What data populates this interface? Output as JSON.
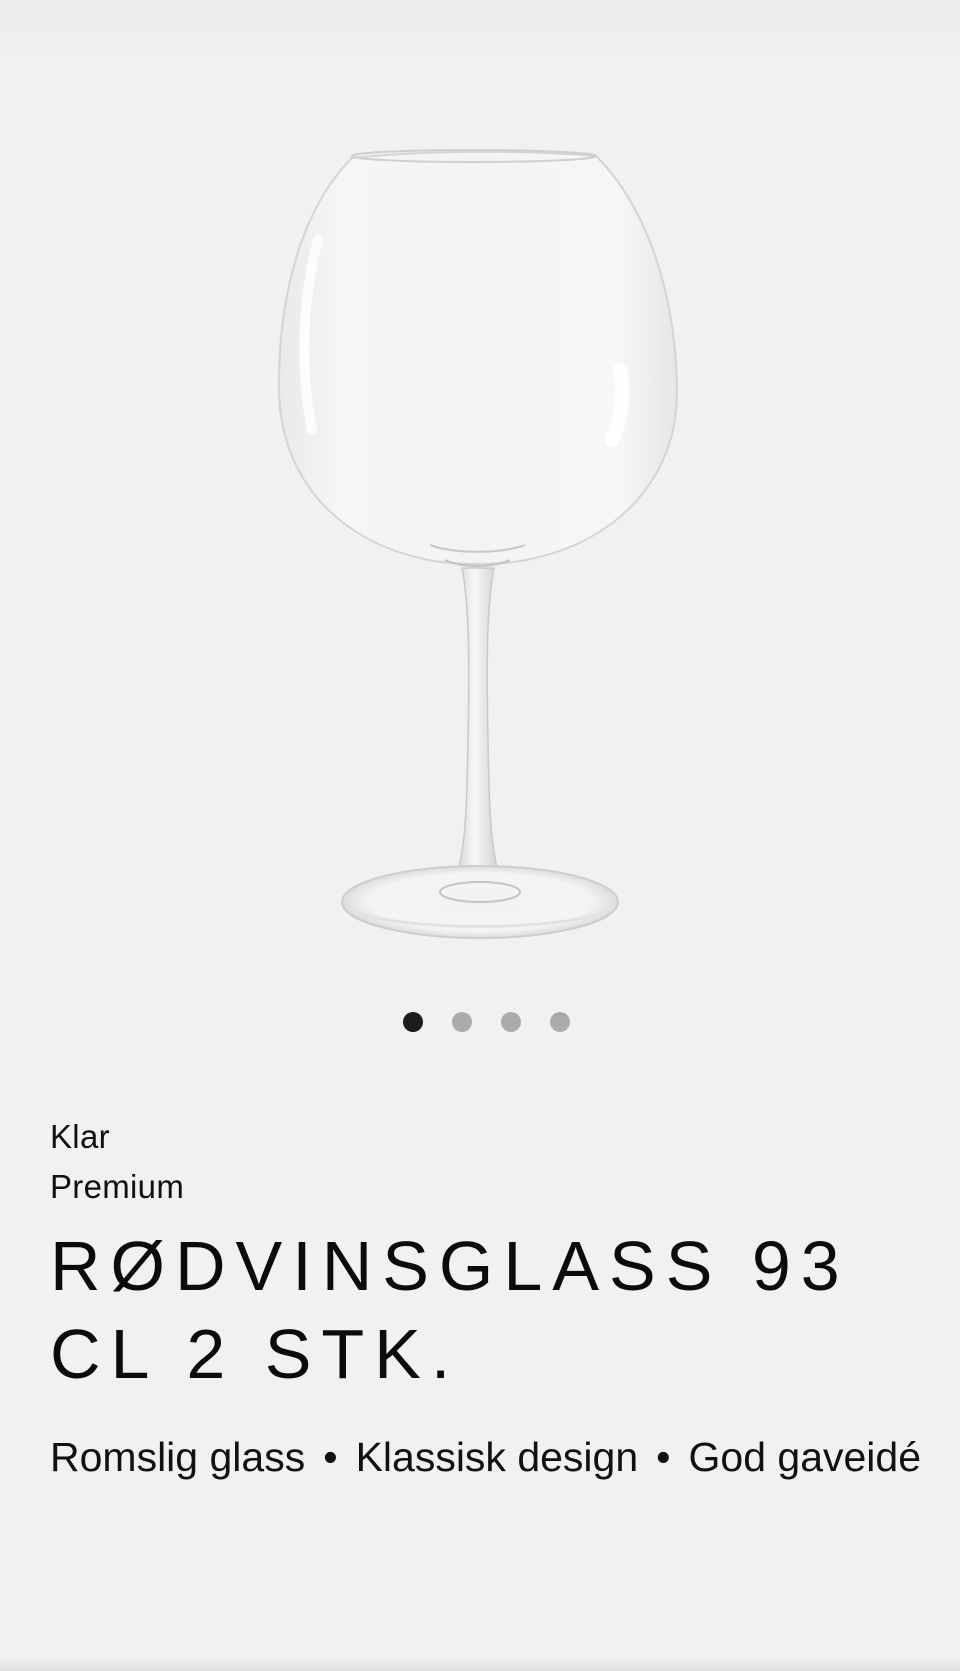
{
  "product": {
    "image_alt": "Rødvinsglass",
    "gallery": {
      "count": 4,
      "active_index": 0
    },
    "variant_lines": [
      "Klar",
      "Premium"
    ],
    "title": "RØDVINSGLASS 93 CL 2 STK.",
    "features": [
      "Romslig glass",
      "Klassisk design",
      "God gaveidé"
    ],
    "separator": "•"
  },
  "colors": {
    "background": "#f1f1f1",
    "dot_active": "#1c1c1c",
    "dot_inactive": "#ababab"
  }
}
